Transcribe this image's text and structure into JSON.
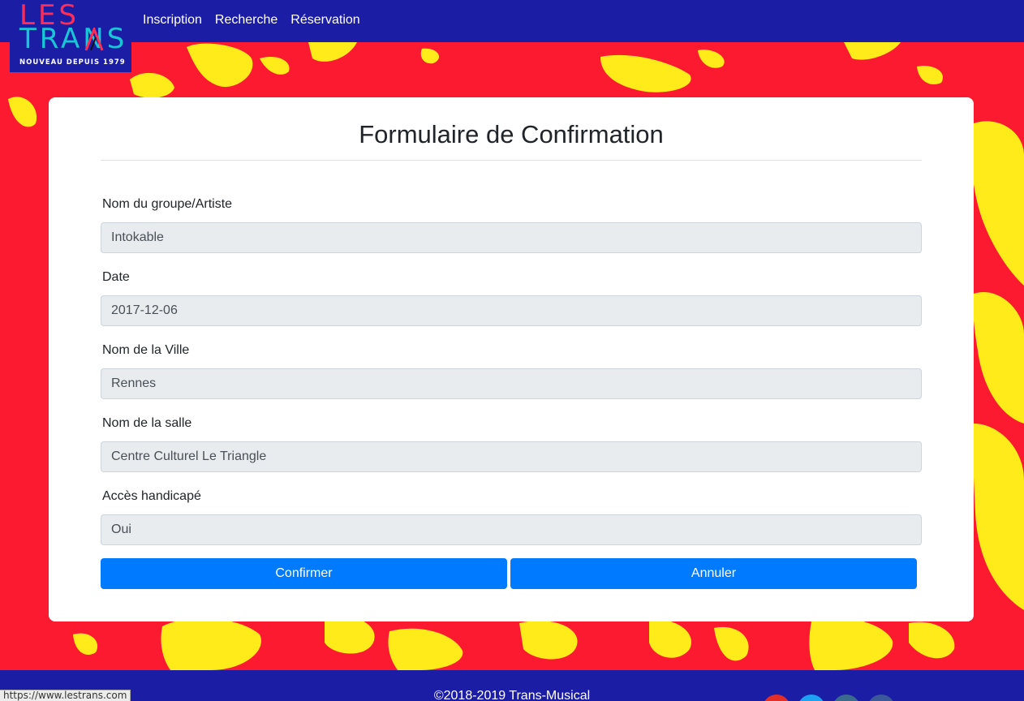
{
  "brand": {
    "line1": "LES",
    "line2": "TRANS",
    "tagline": "NOUVEAU DEPUIS 1979"
  },
  "nav": {
    "items": [
      "Inscription",
      "Recherche",
      "Réservation"
    ]
  },
  "form": {
    "title": "Formulaire de Confirmation",
    "fields": [
      {
        "label": "Nom du groupe/Artiste",
        "value": "Intokable"
      },
      {
        "label": "Date",
        "value": "2017-12-06"
      },
      {
        "label": "Nom de la Ville",
        "value": "Rennes"
      },
      {
        "label": "Nom de la salle",
        "value": "Centre Culturel Le Triangle"
      },
      {
        "label": "Accès handicapé",
        "value": "Oui"
      }
    ],
    "confirm_label": "Confirmer",
    "cancel_label": "Annuler"
  },
  "footer": {
    "copyright": "©2018-2019 Trans-Musical",
    "social": [
      {
        "icon": "youtube-icon",
        "color": "#e52d27"
      },
      {
        "icon": "twitter-icon",
        "color": "#1da1f2"
      },
      {
        "icon": "linkedin-icon",
        "color": "#3b6b8c"
      },
      {
        "icon": "facebook-icon",
        "color": "#3b5998"
      }
    ]
  },
  "status_bar": {
    "url": "https://www.lestrans.com"
  },
  "colors": {
    "navbar": "#1b1ea4",
    "background_red": "#fb1a2f",
    "splatter_yellow": "#ffeb1a",
    "primary_button": "#007bff"
  }
}
